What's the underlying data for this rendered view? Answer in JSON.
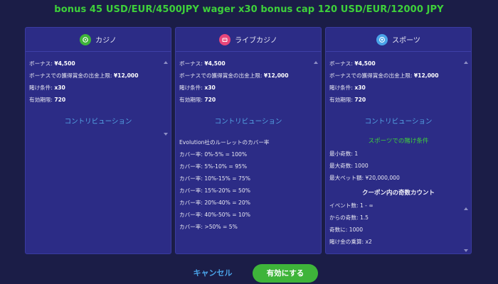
{
  "header": {
    "title": "bonus 45 USD/EUR/4500JPY wager x30 bonus cap 120 USD/EUR/12000 JPY"
  },
  "colors": {
    "accent_green": "#3ed13a",
    "link_blue": "#55a7e6",
    "panel_bg": "#2c2c86",
    "page_bg": "#1b1d47"
  },
  "panels": [
    {
      "title": "カジノ",
      "icon": "casino-icon",
      "icon_color": "#3eb43a",
      "lines": [
        {
          "label": "ボーナス: ",
          "value": "¥4,500"
        },
        {
          "label": "ボーナスでの獲得賞金の出金上限: ",
          "value": "¥12,000"
        },
        {
          "label": "賭け条件: ",
          "value": "x30"
        },
        {
          "label": "有効期限: ",
          "value": "720"
        }
      ],
      "contribution": "コントリビューション"
    },
    {
      "title": "ライブカジノ",
      "icon": "live-casino-icon",
      "icon_color": "#e8457a",
      "lines": [
        {
          "label": "ボーナス: ",
          "value": "¥4,500"
        },
        {
          "label": "ボーナスでの獲得賞金の出金上限: ",
          "value": "¥12,000"
        },
        {
          "label": "賭け条件: ",
          "value": "x30"
        },
        {
          "label": "有効期限: ",
          "value": "720"
        }
      ],
      "contribution": "コントリビューション",
      "roulette_title": "Evolution社のルーレットのカバー率",
      "coverage": [
        "カバー率: 0%-5% = 100%",
        "カバー率: 5%-10% = 95%",
        "カバー率: 10%-15% = 75%",
        "カバー率: 15%-20% = 50%",
        "カバー率: 20%-40% = 20%",
        "カバー率: 40%-50% = 10%",
        "カバー率: >50% = 5%"
      ]
    },
    {
      "title": "スポーツ",
      "icon": "sports-icon",
      "icon_color": "#4aa3e8",
      "lines": [
        {
          "label": "ボーナス: ",
          "value": "¥4,500"
        },
        {
          "label": "ボーナスでの獲得賞金の出金上限: ",
          "value": "¥12,000"
        },
        {
          "label": "賭け条件: ",
          "value": "x30"
        },
        {
          "label": "有効期限: ",
          "value": "720"
        }
      ],
      "contribution": "コントリビューション",
      "sports_title": "スポーツでの賭け条件",
      "sports_lines": [
        "最小奇数: 1",
        "最大奇数: 1000",
        "最大ベット額: ¥20,000,000"
      ],
      "coupon_title": "クーポン内の奇数カウント",
      "coupon_lines": [
        "イベント数: 1 - ∞",
        "からの奇数: 1.5",
        "奇数に: 1000",
        "賭け金の乗算: x2"
      ]
    }
  ],
  "buttons": {
    "cancel": "キャンセル",
    "activate": "有効にする"
  }
}
